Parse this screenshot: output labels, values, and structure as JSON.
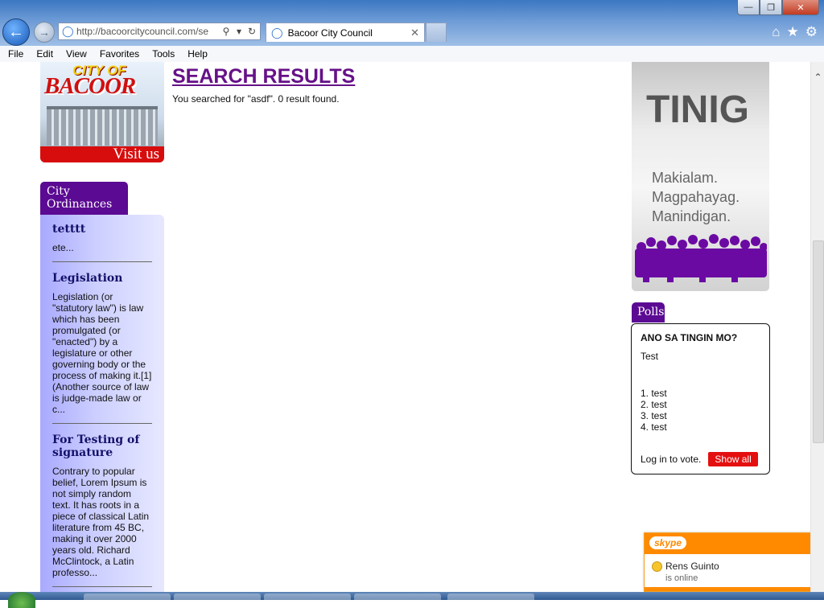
{
  "browser": {
    "address": "http://bacoorcitycouncil.com/se",
    "tab_title": "Bacoor City Council",
    "menu": [
      "File",
      "Edit",
      "View",
      "Favorites",
      "Tools",
      "Help"
    ]
  },
  "banner": {
    "logo_small": "CITY OF",
    "logo_big": "BACOOR",
    "visit": "Visit us"
  },
  "ordinances": {
    "tab": "City Ordinances",
    "items": [
      {
        "title": "tetttt",
        "excerpt": "ete..."
      },
      {
        "title": "Legislation",
        "excerpt": "Legislation (or \"statutory law\") is law which has been promulgated (or \"enacted\") by a legislature or other governing body or the process of making it.[1] (Another source of law is judge-made law or c..."
      },
      {
        "title": "For Testing of signature",
        "excerpt": "Contrary to popular belief, Lorem Ipsum is not simply random text. It has roots in a piece of classical Latin literature from 45 BC, making it over 2000 years old. Richard McClintock, a Latin professo..."
      }
    ]
  },
  "search": {
    "title": "SEARCH RESULTS",
    "info": "You searched for \"asdf\". 0 result found."
  },
  "tinig": {
    "title": "TINIG",
    "lines": [
      "Makialam.",
      "Magpahayag.",
      "Manindigan."
    ]
  },
  "polls": {
    "tab": "Polls",
    "question": "ANO SA TINGIN MO?",
    "description": "Test",
    "options": [
      "1. test",
      "2. test",
      "3. test",
      "4. test"
    ],
    "login_text": "Log in to vote.",
    "show_all": "Show all"
  },
  "skype": {
    "logo": "skype",
    "contact": "Rens Guinto",
    "status": "is online"
  },
  "colors": {
    "brand_purple": "#5b0a93",
    "accent_red": "#e4100f",
    "skype_orange": "#ff8a00"
  }
}
